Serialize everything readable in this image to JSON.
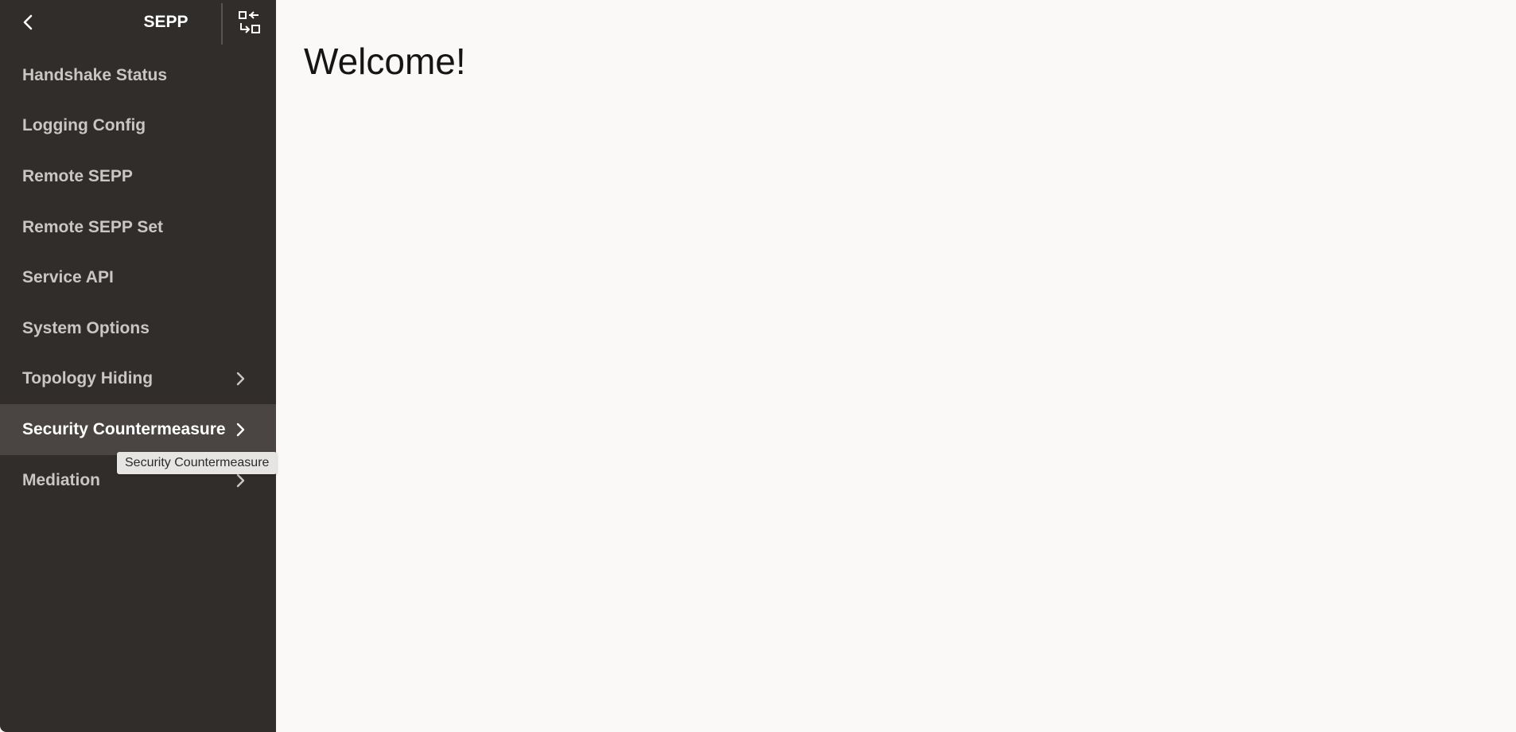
{
  "sidebar": {
    "title": "SEPP",
    "items": [
      {
        "label": "Handshake Status",
        "has_children": false
      },
      {
        "label": "Logging Config",
        "has_children": false
      },
      {
        "label": "Remote SEPP",
        "has_children": false
      },
      {
        "label": "Remote SEPP Set",
        "has_children": false
      },
      {
        "label": "Service API",
        "has_children": false
      },
      {
        "label": "System Options",
        "has_children": false
      },
      {
        "label": "Topology Hiding",
        "has_children": true
      },
      {
        "label": "Security Countermeasure",
        "has_children": true,
        "active": true
      },
      {
        "label": "Mediation",
        "has_children": true
      }
    ],
    "tooltip": "Security Countermeasure"
  },
  "main": {
    "heading": "Welcome!"
  },
  "colors": {
    "sidebar_bg": "#312d2a",
    "sidebar_active_bg": "#4a4542",
    "main_bg": "#faf9f8",
    "text_inactive": "#c9c6c3"
  },
  "icons": {
    "back": "chevron-left-icon",
    "switch": "switch-view-icon",
    "submenu": "chevron-right-icon"
  }
}
